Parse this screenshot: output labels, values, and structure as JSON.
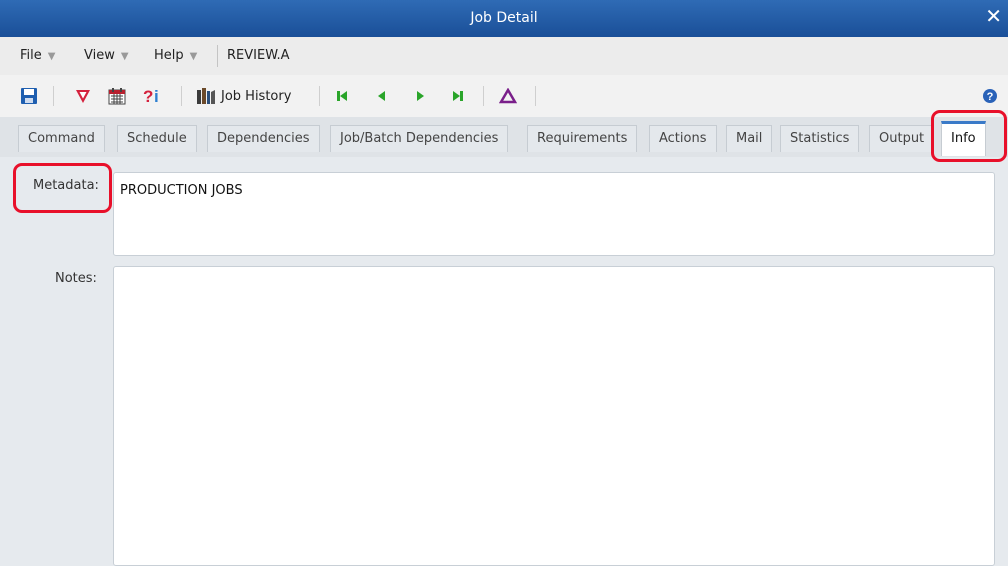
{
  "window": {
    "title": "Job Detail"
  },
  "menu": {
    "file": "File",
    "view": "View",
    "help": "Help",
    "job_name": "REVIEW.A"
  },
  "toolbar": {
    "job_history": "Job History"
  },
  "tabs": [
    "Command",
    "Schedule",
    "Dependencies",
    "Job/Batch Dependencies",
    "Requirements",
    "Actions",
    "Mail",
    "Statistics",
    "Output",
    "Info"
  ],
  "active_tab": "Info",
  "info": {
    "metadata_label": "Metadata:",
    "metadata_value": "PRODUCTION JOBS",
    "notes_label": "Notes:",
    "notes_value": ""
  },
  "colors": {
    "titlebar": "#2a64ad",
    "highlight": "#e8102a",
    "nav_green": "#2aa52a",
    "triangle_purple": "#7a1f8a"
  }
}
